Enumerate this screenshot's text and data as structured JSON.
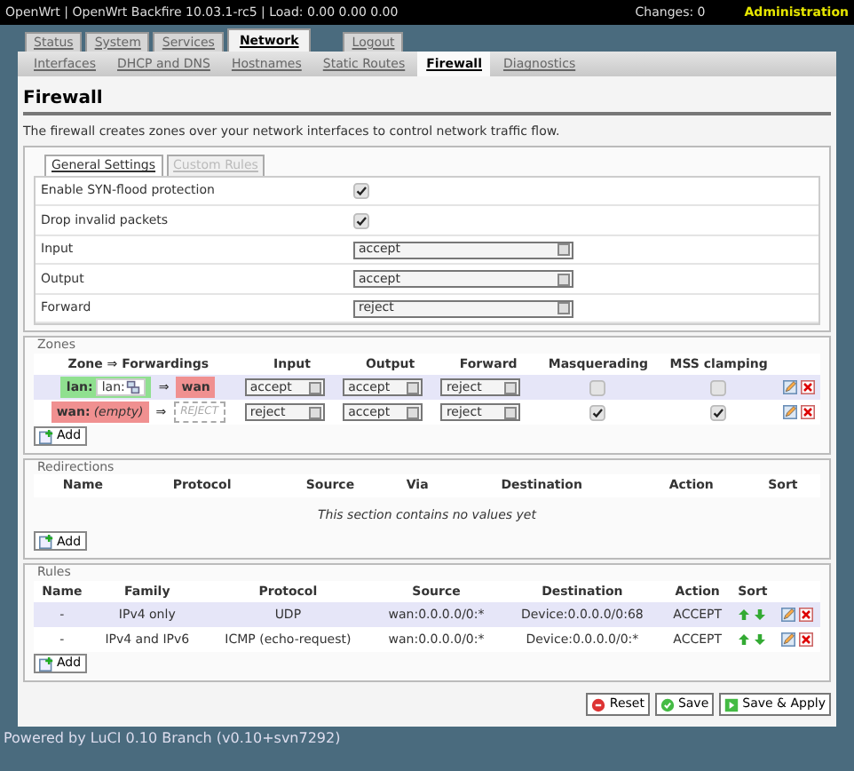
{
  "header": {
    "title": "OpenWrt | OpenWrt Backfire 10.03.1-rc5 | Load: 0.00 0.00 0.00",
    "changes": "Changes: 0",
    "admin": "Administration"
  },
  "main_tabs": [
    {
      "label": "Status",
      "selected": false,
      "kind": "tab"
    },
    {
      "label": "System",
      "selected": false,
      "kind": "tab"
    },
    {
      "label": "Services",
      "selected": false,
      "kind": "tab"
    },
    {
      "label": "Network",
      "selected": true,
      "kind": "tab"
    },
    {
      "label": "Logout",
      "selected": false,
      "kind": "logout"
    }
  ],
  "sub_tabs": [
    {
      "label": "Interfaces",
      "selected": false
    },
    {
      "label": "DHCP and DNS",
      "selected": false
    },
    {
      "label": "Hostnames",
      "selected": false
    },
    {
      "label": "Static Routes",
      "selected": false
    },
    {
      "label": "Firewall",
      "selected": true
    },
    {
      "label": "Diagnostics",
      "selected": false
    }
  ],
  "page": {
    "title": "Firewall",
    "description": "The firewall creates zones over your network interfaces to control network traffic flow."
  },
  "general": {
    "tabs": [
      {
        "label": "General Settings",
        "selected": true
      },
      {
        "label": "Custom Rules",
        "selected": false
      }
    ],
    "settings": [
      {
        "kind": "checkbox",
        "label": "Enable SYN-flood protection",
        "checked": true
      },
      {
        "kind": "checkbox",
        "label": "Drop invalid packets",
        "checked": true
      },
      {
        "kind": "select",
        "label": "Input",
        "value": "accept"
      },
      {
        "kind": "select",
        "label": "Output",
        "value": "accept"
      },
      {
        "kind": "select",
        "label": "Forward",
        "value": "reject"
      }
    ]
  },
  "zones": {
    "legend": "Zones",
    "columns": [
      "Zone ⇒ Forwardings",
      "Input",
      "Output",
      "Forward",
      "Masquerading",
      "MSS clamping"
    ],
    "rows": [
      {
        "zone": {
          "name": "lan:",
          "color": "#90e090",
          "networks": [
            "lan:"
          ]
        },
        "arrow": "⇒",
        "targets": [
          {
            "kind": "zone",
            "label": "wan",
            "color": "#f09090"
          }
        ],
        "input": "accept",
        "output": "accept",
        "forward": "reject",
        "masquerading": false,
        "mss_clamping": false
      },
      {
        "zone": {
          "name": "wan:",
          "color": "#f09090",
          "empty_text": "(empty)"
        },
        "arrow": "⇒",
        "targets": [
          {
            "kind": "policy",
            "label": "REJECT"
          }
        ],
        "input": "reject",
        "output": "accept",
        "forward": "reject",
        "masquerading": true,
        "mss_clamping": true
      }
    ],
    "add": "Add"
  },
  "redirections": {
    "legend": "Redirections",
    "columns": [
      "Name",
      "Protocol",
      "Source",
      "Via",
      "Destination",
      "Action",
      "Sort"
    ],
    "empty_text": "This section contains no values yet",
    "add": "Add"
  },
  "rules": {
    "legend": "Rules",
    "columns": [
      "Name",
      "Family",
      "Protocol",
      "Source",
      "Destination",
      "Action",
      "Sort"
    ],
    "rows": [
      [
        "-",
        "IPv4 only",
        "UDP",
        "wan:0.0.0.0/0:*",
        "Device:0.0.0.0/0:68",
        "ACCEPT"
      ],
      [
        "-",
        "IPv4 and IPv6",
        "ICMP (echo-request)",
        "wan:0.0.0.0/0:*",
        "Device:0.0.0.0/0:*",
        "ACCEPT"
      ]
    ],
    "add": "Add"
  },
  "actions": [
    {
      "kind": "reset",
      "label": "Reset"
    },
    {
      "kind": "save",
      "label": "Save"
    },
    {
      "kind": "apply",
      "label": "Save & Apply"
    }
  ],
  "footer": "Powered by LuCI 0.10 Branch (v0.10+svn7292)"
}
